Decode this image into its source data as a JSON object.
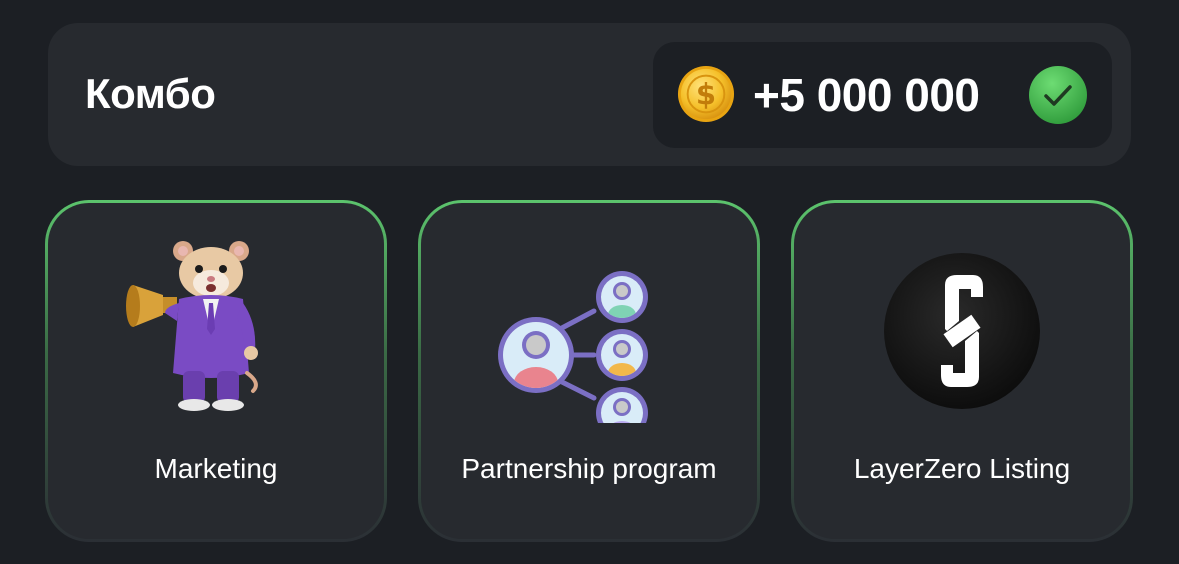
{
  "combo": {
    "title": "Комбо",
    "reward_amount": "+5 000 000",
    "coin_icon": "coin-dollar-icon",
    "status_icon": "check-circle-icon",
    "status": "completed"
  },
  "cards": [
    {
      "label": "Marketing",
      "image": "hamster-megaphone-image",
      "status": "found"
    },
    {
      "label": "Partnership program",
      "image": "partnership-network-image",
      "status": "found"
    },
    {
      "label": "LayerZero Listing",
      "image": "layerzero-logo-image",
      "status": "found"
    }
  ],
  "colors": {
    "background": "#1c1f24",
    "panel": "#272a2f",
    "accent_green": "#5cc46d",
    "coin_gold": "#f5c02a"
  }
}
